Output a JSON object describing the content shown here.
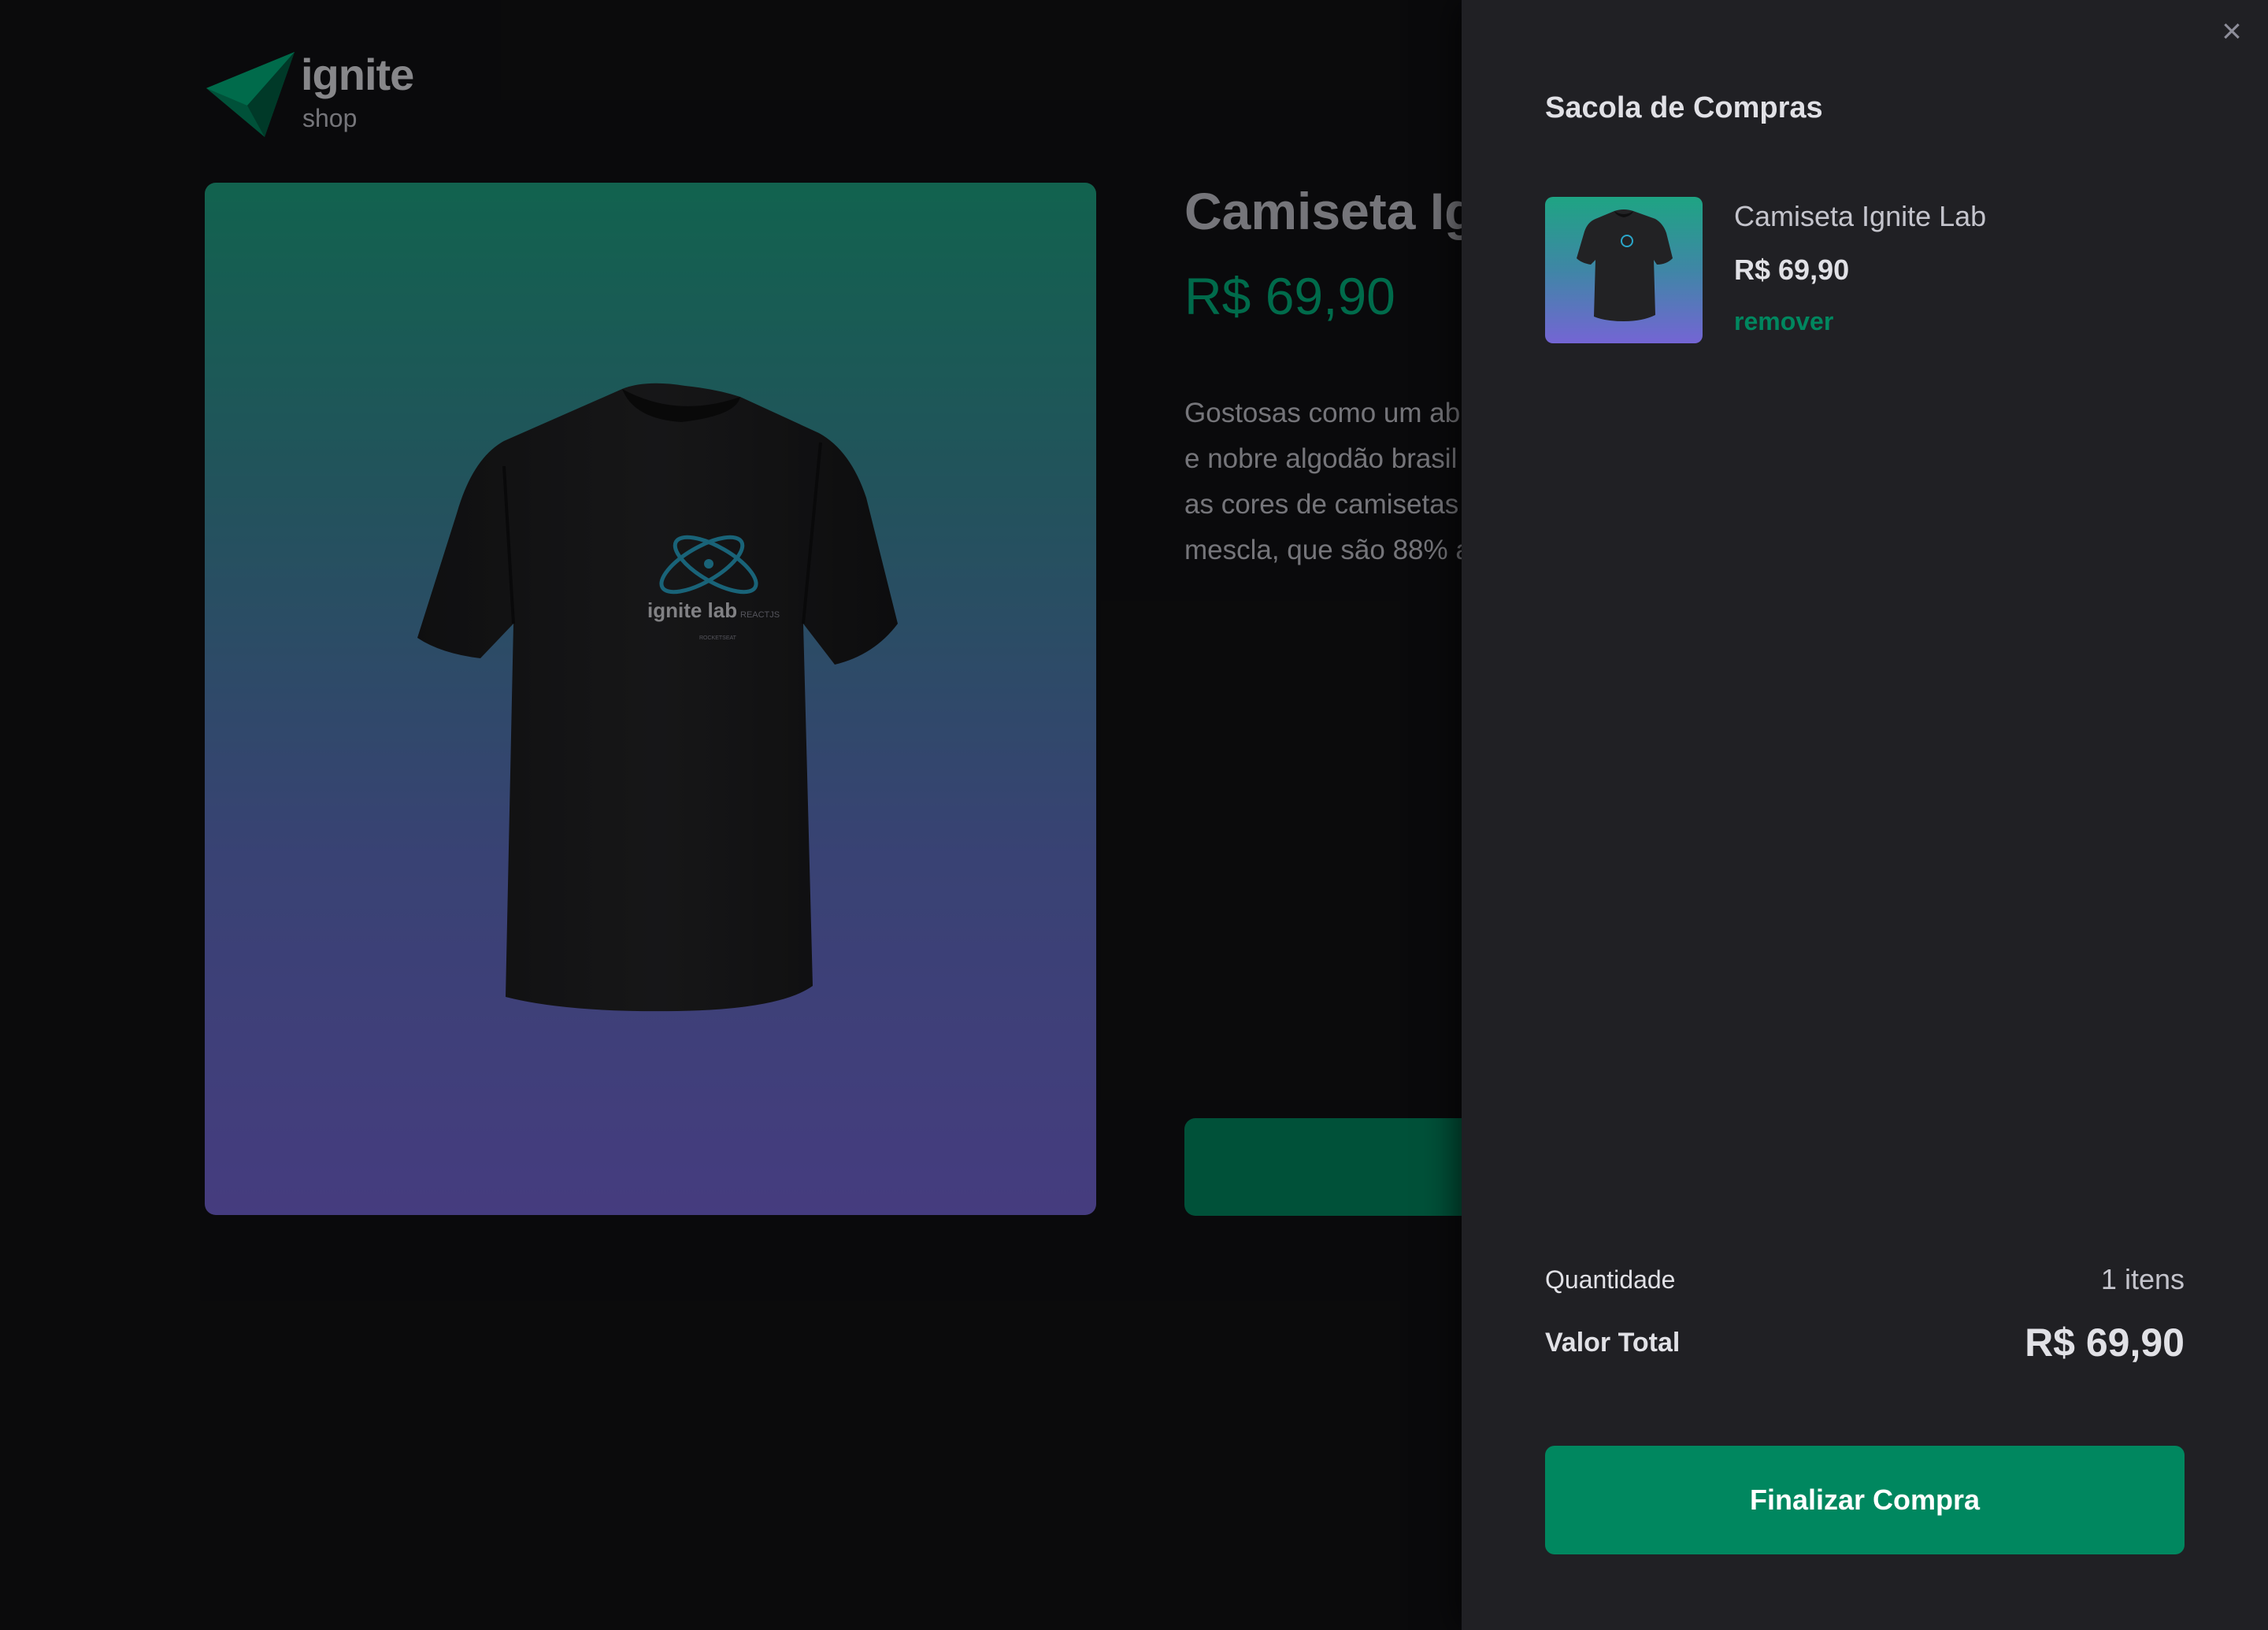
{
  "brand": {
    "name": "ignite",
    "sub": "shop",
    "logo_icon": "triangle-arrow-icon",
    "colors": {
      "accent": "#00875f",
      "accent_light": "#00b37e",
      "background": "#121214",
      "drawer": "#202024"
    }
  },
  "product": {
    "title": "Camiseta Ignite Lab",
    "price": "R$ 69,90",
    "description_lines": [
      "Gostosas como um ab",
      "e nobre algodão brasil",
      "as cores de camisetas",
      "mescla, que são 88% a"
    ],
    "image_icon": "tshirt-image",
    "shirt_print": {
      "logo": "ignite lab",
      "tag": "REACTJS",
      "small": "ROCKETSEAT"
    }
  },
  "cart": {
    "title": "Sacola de Compras",
    "close_icon": "close-icon",
    "close_label": "×",
    "items": [
      {
        "name": "Camiseta Ignite Lab",
        "price": "R$ 69,90",
        "remove_label": "remover"
      }
    ],
    "quantity_label": "Quantidade",
    "quantity_value": "1 itens",
    "total_label": "Valor Total",
    "total_value": "R$ 69,90",
    "checkout_label": "Finalizar Compra"
  }
}
